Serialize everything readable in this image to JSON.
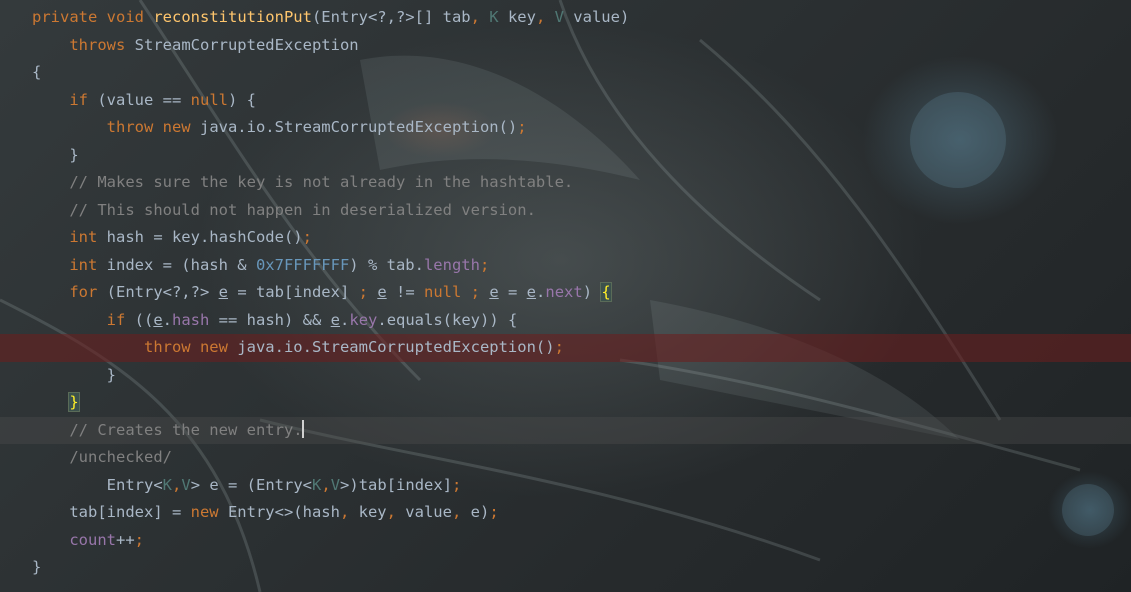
{
  "editor": {
    "language": "Java",
    "lines": [
      {
        "tokens": [
          {
            "t": "private void ",
            "c": "kw"
          },
          {
            "t": "reconstitutionPut",
            "c": "fn"
          },
          {
            "t": "(Entry<?,?>[] tab",
            "c": "txt"
          },
          {
            "t": ", ",
            "c": "kw"
          },
          {
            "t": "K",
            "c": "tp"
          },
          {
            "t": " key",
            "c": "txt"
          },
          {
            "t": ", ",
            "c": "kw"
          },
          {
            "t": "V",
            "c": "tp"
          },
          {
            "t": " value)",
            "c": "txt"
          }
        ]
      },
      {
        "tokens": [
          {
            "t": "    ",
            "c": "txt"
          },
          {
            "t": "throws ",
            "c": "kw"
          },
          {
            "t": "StreamCorruptedException",
            "c": "txt"
          }
        ]
      },
      {
        "tokens": [
          {
            "t": "{",
            "c": "txt"
          }
        ]
      },
      {
        "tokens": [
          {
            "t": "    ",
            "c": "txt"
          },
          {
            "t": "if ",
            "c": "kw"
          },
          {
            "t": "(value == ",
            "c": "txt"
          },
          {
            "t": "null",
            "c": "kw"
          },
          {
            "t": ") {",
            "c": "txt"
          }
        ]
      },
      {
        "tokens": [
          {
            "t": "        ",
            "c": "txt"
          },
          {
            "t": "throw new ",
            "c": "kw"
          },
          {
            "t": "java.io.StreamCorruptedException()",
            "c": "txt"
          },
          {
            "t": ";",
            "c": "kw"
          }
        ]
      },
      {
        "tokens": [
          {
            "t": "    }",
            "c": "txt"
          }
        ]
      },
      {
        "tokens": [
          {
            "t": "    ",
            "c": "txt"
          },
          {
            "t": "// Makes sure the key is not already in the hashtable.",
            "c": "cm"
          }
        ]
      },
      {
        "tokens": [
          {
            "t": "    ",
            "c": "txt"
          },
          {
            "t": "// This should not happen in deserialized version.",
            "c": "cm"
          }
        ]
      },
      {
        "tokens": [
          {
            "t": "    ",
            "c": "txt"
          },
          {
            "t": "int ",
            "c": "kw"
          },
          {
            "t": "hash = key.hashCode()",
            "c": "txt"
          },
          {
            "t": ";",
            "c": "kw"
          }
        ]
      },
      {
        "tokens": [
          {
            "t": "    ",
            "c": "txt"
          },
          {
            "t": "int ",
            "c": "kw"
          },
          {
            "t": "index = (hash & ",
            "c": "txt"
          },
          {
            "t": "0x7FFFFFFF",
            "c": "num"
          },
          {
            "t": ") % tab.",
            "c": "txt"
          },
          {
            "t": "length",
            "c": "fld"
          },
          {
            "t": ";",
            "c": "kw"
          }
        ]
      },
      {
        "tokens": [
          {
            "t": "    ",
            "c": "txt"
          },
          {
            "t": "for ",
            "c": "kw"
          },
          {
            "t": "(Entry<?,?> ",
            "c": "txt"
          },
          {
            "t": "e",
            "c": "u"
          },
          {
            "t": " = tab[index] ",
            "c": "txt"
          },
          {
            "t": "; ",
            "c": "kw"
          },
          {
            "t": "e",
            "c": "u"
          },
          {
            "t": " != ",
            "c": "txt"
          },
          {
            "t": "null ",
            "c": "kw"
          },
          {
            "t": "; ",
            "c": "kw"
          },
          {
            "t": "e",
            "c": "u"
          },
          {
            "t": " = ",
            "c": "txt"
          },
          {
            "t": "e",
            "c": "u"
          },
          {
            "t": ".",
            "c": "txt"
          },
          {
            "t": "next",
            "c": "fld"
          },
          {
            "t": ") ",
            "c": "txt"
          },
          {
            "t": "{",
            "c": "brace-hl"
          }
        ]
      },
      {
        "tokens": [
          {
            "t": "        ",
            "c": "txt"
          },
          {
            "t": "if ",
            "c": "kw"
          },
          {
            "t": "((",
            "c": "txt"
          },
          {
            "t": "e",
            "c": "u"
          },
          {
            "t": ".",
            "c": "txt"
          },
          {
            "t": "hash",
            "c": "fld"
          },
          {
            "t": " == hash) && ",
            "c": "txt"
          },
          {
            "t": "e",
            "c": "u"
          },
          {
            "t": ".",
            "c": "txt"
          },
          {
            "t": "key",
            "c": "fld"
          },
          {
            "t": ".equals(key)) {",
            "c": "txt"
          }
        ]
      },
      {
        "tokens": [
          {
            "t": "            ",
            "c": "txt"
          },
          {
            "t": "throw new ",
            "c": "kw"
          },
          {
            "t": "java.io.StreamCorruptedException()",
            "c": "txt"
          },
          {
            "t": ";",
            "c": "kw"
          }
        ]
      },
      {
        "tokens": [
          {
            "t": "        }",
            "c": "txt"
          }
        ]
      },
      {
        "tokens": [
          {
            "t": "    ",
            "c": "txt"
          },
          {
            "t": "}",
            "c": "brace-hl"
          }
        ]
      },
      {
        "tokens": [
          {
            "t": "    ",
            "c": "txt"
          },
          {
            "t": "// Creates the new entry.",
            "c": "cm"
          }
        ]
      },
      {
        "tokens": [
          {
            "t": "    ",
            "c": "txt"
          },
          {
            "t": "/unchecked/",
            "c": "cm"
          }
        ]
      },
      {
        "tokens": [
          {
            "t": "        Entry<",
            "c": "txt"
          },
          {
            "t": "K",
            "c": "tp"
          },
          {
            "t": ",",
            "c": "kw"
          },
          {
            "t": "V",
            "c": "tp"
          },
          {
            "t": "> e = (Entry<",
            "c": "txt"
          },
          {
            "t": "K",
            "c": "tp"
          },
          {
            "t": ",",
            "c": "kw"
          },
          {
            "t": "V",
            "c": "tp"
          },
          {
            "t": ">)tab[index]",
            "c": "txt"
          },
          {
            "t": ";",
            "c": "kw"
          }
        ]
      },
      {
        "tokens": [
          {
            "t": "    tab[index] = ",
            "c": "txt"
          },
          {
            "t": "new ",
            "c": "kw"
          },
          {
            "t": "Entry<>(hash",
            "c": "txt"
          },
          {
            "t": ", ",
            "c": "kw"
          },
          {
            "t": "key",
            "c": "txt"
          },
          {
            "t": ", ",
            "c": "kw"
          },
          {
            "t": "value",
            "c": "txt"
          },
          {
            "t": ", ",
            "c": "kw"
          },
          {
            "t": "e)",
            "c": "txt"
          },
          {
            "t": ";",
            "c": "kw"
          }
        ]
      },
      {
        "tokens": [
          {
            "t": "    ",
            "c": "txt"
          },
          {
            "t": "count",
            "c": "fld"
          },
          {
            "t": "++",
            "c": "txt"
          },
          {
            "t": ";",
            "c": "kw"
          }
        ]
      },
      {
        "tokens": [
          {
            "t": "}",
            "c": "txt"
          }
        ]
      }
    ],
    "highlight": {
      "breakpoint_line": 12,
      "current_line": 15,
      "caret_line": 15
    }
  },
  "colors": {
    "keyword": "#cc7832",
    "function": "#ffc66d",
    "type_param": "#507874",
    "comment": "#808080",
    "number": "#6897bb",
    "field": "#9876aa",
    "text": "#a9b7c6"
  }
}
